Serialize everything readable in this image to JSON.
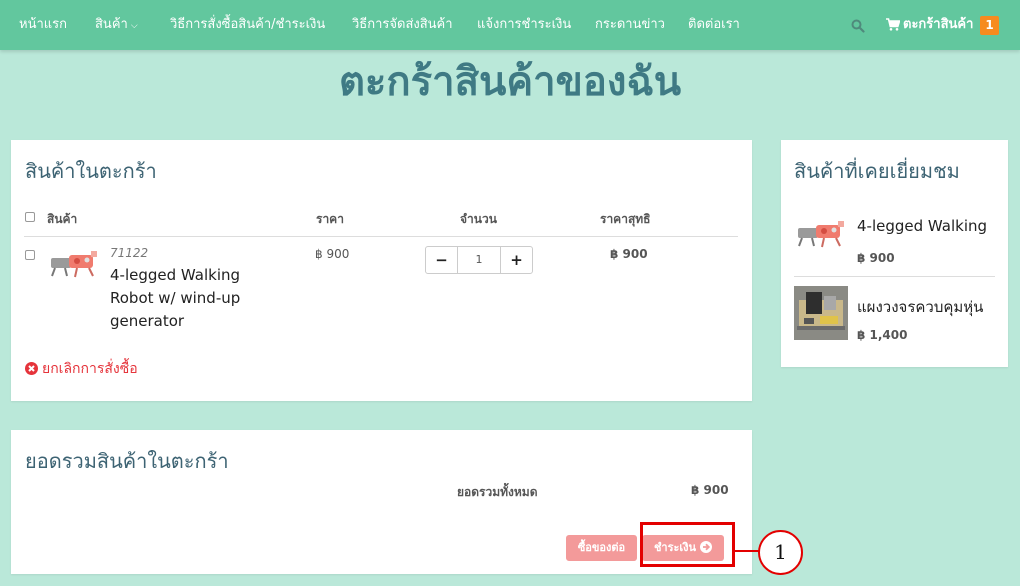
{
  "navbar": {
    "items": [
      {
        "label": "หน้าแรก"
      },
      {
        "label": "สินค้า"
      },
      {
        "label": "วิธีการสั่งซื้อสินค้า/ชำระเงิน"
      },
      {
        "label": "วิธีการจัดส่งสินค้า"
      },
      {
        "label": "แจ้งการชำระเงิน"
      },
      {
        "label": "กระดานข่าว"
      },
      {
        "label": "ติดต่อเรา"
      }
    ],
    "cart_label": "ตะกร้าสินค้า",
    "cart_count": "1"
  },
  "page_title": "ตะกร้าสินค้าของฉัน",
  "cart": {
    "heading": "สินค้าในตะกร้า",
    "columns": {
      "product": "สินค้า",
      "price": "ราคา",
      "quantity": "จำนวน",
      "net_price": "ราคาสุทธิ"
    },
    "items": [
      {
        "sku": "71122",
        "name": "4-legged Walking Robot  w/ wind-up generator",
        "price": "฿ 900",
        "quantity": "1",
        "net_price": "฿ 900"
      }
    ],
    "cancel_label": "ยกเลิกการสั่งซื้อ"
  },
  "summary": {
    "heading": "ยอดรวมสินค้าในตะกร้า",
    "total_label": "ยอดรวมทั้งหมด",
    "total_value": "฿ 900",
    "continue_label": "ซื้อของต่อ",
    "checkout_label": "ชำระเงิน"
  },
  "recently_viewed": {
    "heading": "สินค้าที่เคยเยี่ยมชม",
    "items": [
      {
        "name": "4-legged Walking",
        "price": "฿ 900"
      },
      {
        "name": "แผงวงจรควบคุมหุ่น",
        "price": "฿ 1,400"
      }
    ]
  },
  "annotation": {
    "number": "1"
  },
  "colors": {
    "navbar": "#62c79e",
    "background": "#bae8d9",
    "title": "#3f7a84",
    "button": "#f39a9a",
    "badge": "#f68b1f",
    "danger": "#e5343b",
    "highlight": "#e30000"
  }
}
